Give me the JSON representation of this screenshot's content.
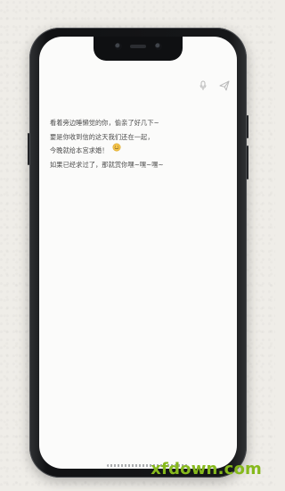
{
  "toolbar": {
    "mic_icon": "mic-icon",
    "send_icon": "send-icon"
  },
  "message": {
    "lines": [
      "看着旁边睡懒觉的你，偷亲了好几下~",
      "要是你收到信的这天我们还在一起，",
      "今晚就给本宫求婚！",
      "如果已经求过了，那就赏你嘿~嘿~嘿~"
    ],
    "emoji_icon": "smile-emoji-icon"
  },
  "watermark": {
    "text": "xfdown.com"
  },
  "colors": {
    "background": "#efede8",
    "screen": "#fbfbfa",
    "text": "#4b4b4b",
    "watermark": "#86b91c"
  }
}
